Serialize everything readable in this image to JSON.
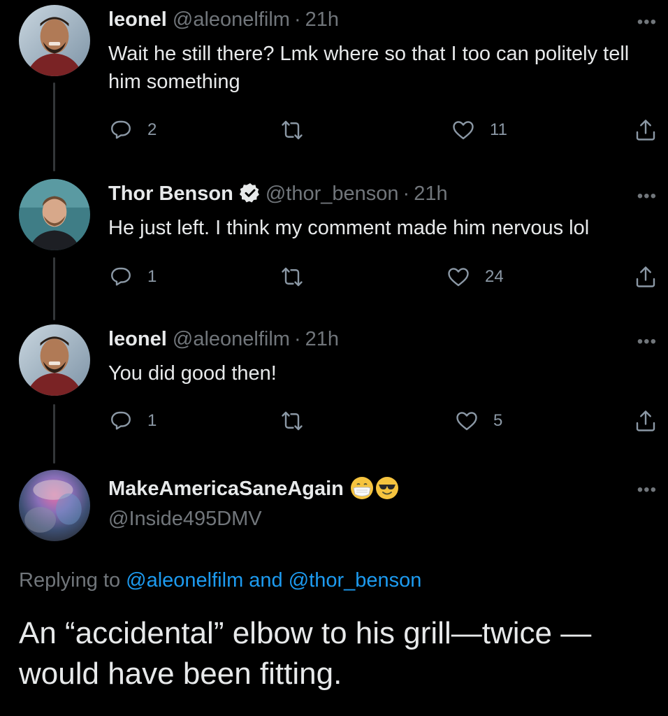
{
  "tweets": [
    {
      "name": "leonel",
      "handle": "@aleonelfilm",
      "time": "21h",
      "text": "Wait he still there? Lmk where so that I too can politely tell him something",
      "replies": "2",
      "retweets": "",
      "likes": "11"
    },
    {
      "name": "Thor Benson",
      "handle": "@thor_benson",
      "time": "21h",
      "text": "He just left. I think my comment made him nervous lol",
      "replies": "1",
      "retweets": "",
      "likes": "24"
    },
    {
      "name": "leonel",
      "handle": "@aleonelfilm",
      "time": "21h",
      "text": "You did good then!",
      "replies": "1",
      "retweets": "",
      "likes": "5"
    }
  ],
  "main_tweet": {
    "name": "MakeAmericaSaneAgain",
    "handle": "@Inside495DMV",
    "replying_prefix": "Replying to",
    "replying_to": "@aleonelfilm and @thor_benson",
    "text": "An “accidental” elbow to his grill—twice —would have been fitting."
  },
  "more_glyph": "•••",
  "icons": {
    "reply": "reply-icon",
    "retweet": "retweet-icon",
    "like": "heart-icon",
    "share": "share-icon",
    "verified": "verified-badge-icon",
    "emoji1": "mask-face-emoji",
    "emoji2": "sunglasses-face-emoji"
  },
  "colors": {
    "background": "#000000",
    "text": "#e7e9ea",
    "secondary": "#71767b",
    "link": "#1d9bf0"
  }
}
